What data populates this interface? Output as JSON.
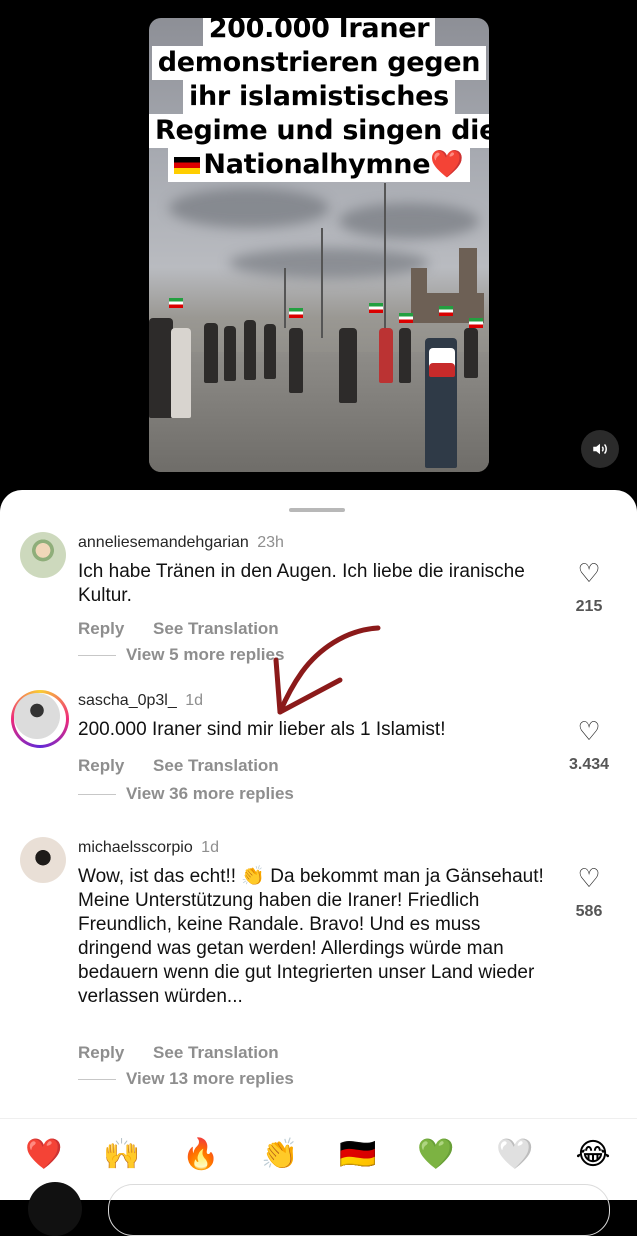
{
  "video": {
    "caption_lines": [
      "200.000 Iraner",
      "demonstrieren gegen",
      "ihr islamistisches",
      "Regime und singen die",
      "Nationalhymne"
    ],
    "caption_heart": "❤️"
  },
  "comments": [
    {
      "username": "anneliesemandehgarian",
      "time": "23h",
      "text": "Ich habe Tränen in den Augen. Ich liebe die iranische Kultur.",
      "reply_label": "Reply",
      "translate_label": "See Translation",
      "more_replies": "View 5 more replies",
      "likes": "215"
    },
    {
      "username": "sascha_0p3l_",
      "time": "1d",
      "text": "200.000 Iraner sind mir lieber als 1 Islamist!",
      "reply_label": "Reply",
      "translate_label": "See Translation",
      "more_replies": "View 36 more replies",
      "likes": "3.434"
    },
    {
      "username": "michaelsscorpio",
      "time": "1d",
      "text": "Wow, ist das echt!! 👏 Da bekommt man ja Gänsehaut! Meine Unterstützung haben die Iraner! Friedlich Freundlich, keine Randale. Bravo! Und es muss dringend was getan werden! Allerdings würde man bedauern wenn die gut Integrierten unser Land wieder verlassen würden...",
      "reply_label": "Reply",
      "translate_label": "See Translation",
      "more_replies": "View 13 more replies",
      "likes": "586"
    }
  ],
  "emoji_reactions": [
    "❤️",
    "🙌",
    "🔥",
    "👏",
    "🇩🇪",
    "💚",
    "🤍",
    "😂"
  ],
  "icons": {
    "sound": "speaker-icon",
    "like": "heart-outline-icon"
  },
  "colors": {
    "annotation_arrow": "#8b1a1a",
    "muted_text": "#8e8e8e"
  }
}
